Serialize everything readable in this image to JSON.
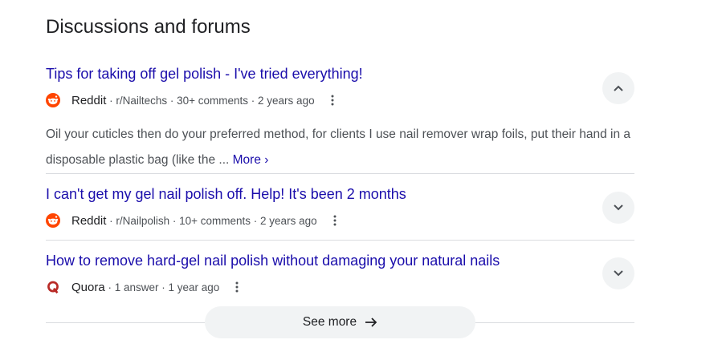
{
  "section": {
    "title": "Discussions and forums"
  },
  "results": [
    {
      "title": "Tips for taking off gel polish - I've tried everything!",
      "source": "Reddit",
      "details": " · r/Nailtechs · 30+ comments · 2 years ago",
      "snippet": "Oil your cuticles then do your preferred method, for clients I use nail remover wrap foils, put their hand in a disposable plastic bag (like the ... ",
      "more_label": "More ›",
      "expanded": true,
      "icon": "reddit-icon"
    },
    {
      "title": "I can't get my gel nail polish off. Help! It's been 2 months",
      "source": "Reddit",
      "details": " · r/Nailpolish · 10+ comments · 2 years ago",
      "expanded": false,
      "icon": "reddit-icon"
    },
    {
      "title": "How to remove hard-gel nail polish without damaging your natural nails",
      "source": "Quora",
      "details": " · 1 answer · 1 year ago",
      "expanded": false,
      "icon": "quora-icon"
    }
  ],
  "footer": {
    "see_more_label": "See more"
  },
  "colors": {
    "link": "#1a0dab",
    "reddit": "#ff4500",
    "quora": "#b92b27",
    "chip": "#f1f3f4"
  }
}
